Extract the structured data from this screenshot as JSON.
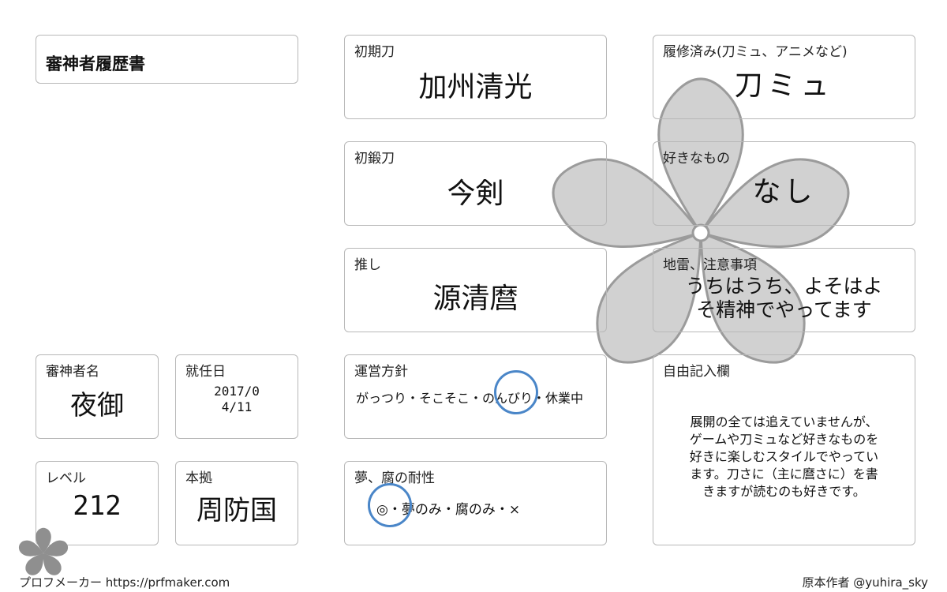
{
  "sheet_title": "審神者履歴書",
  "fields": {
    "shoki_to": {
      "label": "初期刀",
      "value": "加州清光"
    },
    "shotan_to": {
      "label": "初鍛刀",
      "value": "今剣"
    },
    "oshi": {
      "label": "推し",
      "value": "源清麿"
    },
    "rishu": {
      "label": "履修済み(刀ミュ、アニメなど)",
      "value": "刀ミュ"
    },
    "suki": {
      "label": "好きなもの",
      "value": "なし"
    },
    "jirai": {
      "label": "地雷、注意事項",
      "value_line1": "うちはうち、よそはよ",
      "value_line2": "そ精神でやってます"
    },
    "name": {
      "label": "審神者名",
      "value": "夜御"
    },
    "start_date": {
      "label": "就任日",
      "value_line1": "2017/0",
      "value_line2": "4/11"
    },
    "level": {
      "label": "レベル",
      "value": "212"
    },
    "base": {
      "label": "本拠",
      "value": "周防国"
    },
    "policy": {
      "label": "運営方針",
      "options": "がっつり・そこそこ・のんびり・休業中",
      "selected": "のんびり"
    },
    "tolerance": {
      "label": "夢、腐の耐性",
      "options": "◎・夢のみ・腐のみ・×",
      "selected": "◎"
    },
    "free": {
      "label": "自由記入欄",
      "lines": [
        "展開の全ては追えていませんが、",
        "ゲームや刀ミュなど好きなものを",
        "好きに楽しむスタイルでやってい",
        "ます。刀さに（主に麿さに）を書",
        "きますが読むのも好きです。"
      ]
    }
  },
  "footer": {
    "left": "プロフメーカー https://prfmaker.com",
    "right": "原本作者 @yuhira_sky"
  },
  "colors": {
    "circle": "#4a86c8",
    "border": "#b8b8b8",
    "flower": "#b0b0b0"
  }
}
